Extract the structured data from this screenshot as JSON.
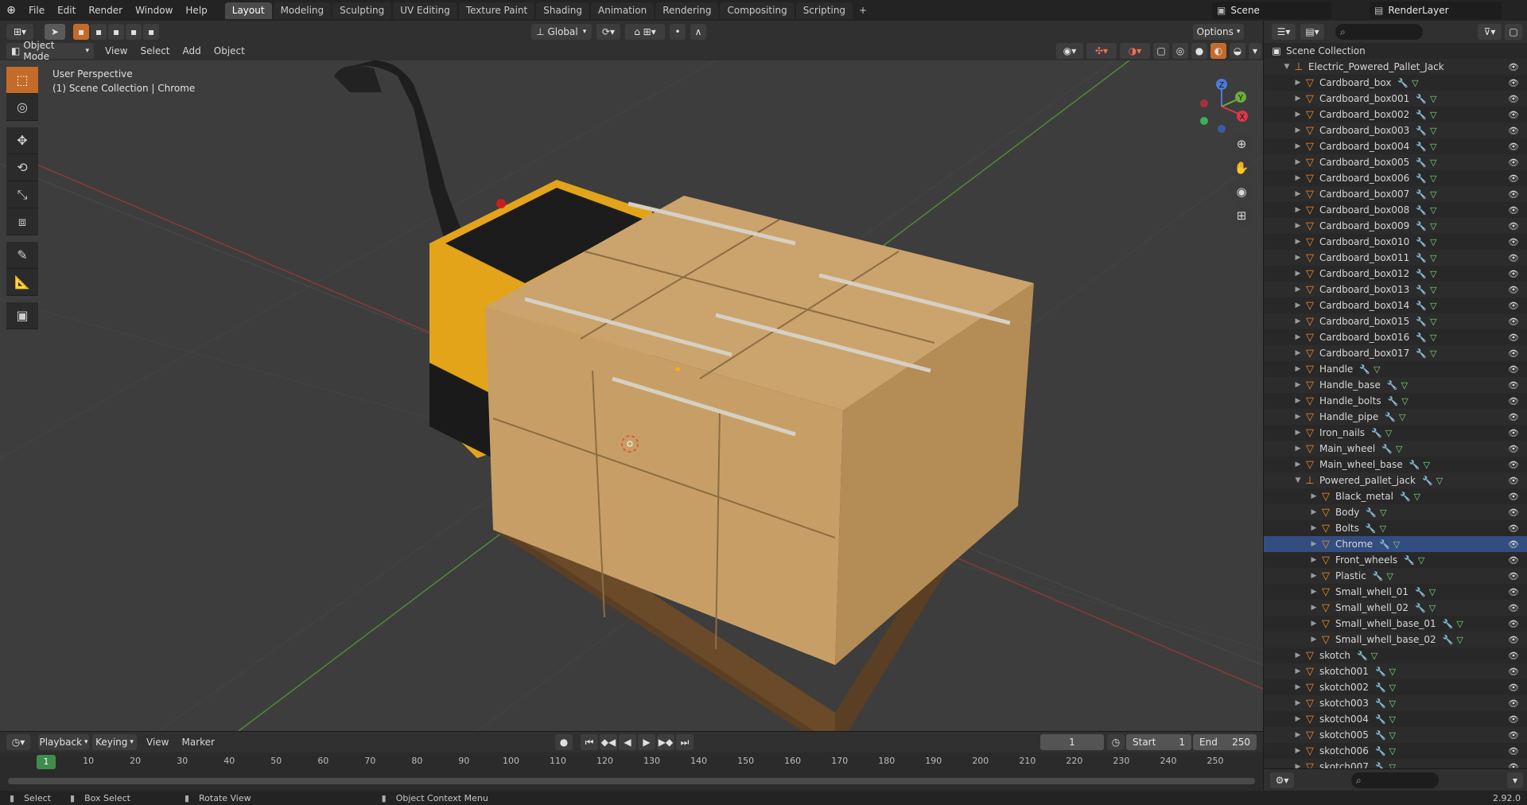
{
  "menu": {
    "file": "File",
    "edit": "Edit",
    "render": "Render",
    "window": "Window",
    "help": "Help"
  },
  "workspaces": [
    "Layout",
    "Modeling",
    "Sculpting",
    "UV Editing",
    "Texture Paint",
    "Shading",
    "Animation",
    "Rendering",
    "Compositing",
    "Scripting"
  ],
  "workspace_add": "+",
  "scene": "Scene",
  "render_layer": "RenderLayer",
  "header": {
    "mode": "Object Mode",
    "view": "View",
    "select": "Select",
    "add": "Add",
    "object": "Object",
    "orientation": "Global",
    "options": "Options"
  },
  "viewport": {
    "perspective": "User Perspective",
    "collection": "(1) Scene Collection | Chrome"
  },
  "gizmo": {
    "x": "X",
    "y": "Y",
    "z": "Z"
  },
  "outliner": {
    "title": "Scene Collection",
    "root": "Electric_Powered_Pallet_Jack",
    "items": [
      "Cardboard_box",
      "Cardboard_box001",
      "Cardboard_box002",
      "Cardboard_box003",
      "Cardboard_box004",
      "Cardboard_box005",
      "Cardboard_box006",
      "Cardboard_box007",
      "Cardboard_box008",
      "Cardboard_box009",
      "Cardboard_box010",
      "Cardboard_box011",
      "Cardboard_box012",
      "Cardboard_box013",
      "Cardboard_box014",
      "Cardboard_box015",
      "Cardboard_box016",
      "Cardboard_box017",
      "Handle",
      "Handle_base",
      "Handle_bolts",
      "Handle_pipe",
      "Iron_nails",
      "Main_wheel",
      "Main_wheel_base"
    ],
    "sub_collection": "Powered_pallet_jack",
    "sub_items": [
      "Black_metal",
      "Body",
      "Bolts",
      "Chrome",
      "Front_wheels",
      "Plastic",
      "Small_whell_01",
      "Small_whell_02",
      "Small_whell_base_01",
      "Small_whell_base_02"
    ],
    "tail_items": [
      "skotch",
      "skotch001",
      "skotch002",
      "skotch003",
      "skotch004",
      "skotch005",
      "skotch006",
      "skotch007"
    ],
    "selected": "Chrome"
  },
  "timeline": {
    "playback": "Playback",
    "keying": "Keying",
    "view": "View",
    "marker": "Marker",
    "current_frame": "1",
    "start_label": "Start",
    "start": "1",
    "end_label": "End",
    "end": "250",
    "ticks": [
      "1",
      "10",
      "20",
      "30",
      "40",
      "50",
      "60",
      "70",
      "80",
      "90",
      "100",
      "110",
      "120",
      "130",
      "140",
      "150",
      "160",
      "170",
      "180",
      "190",
      "200",
      "210",
      "220",
      "230",
      "240",
      "250"
    ]
  },
  "status": {
    "select": "Select",
    "box_select": "Box Select",
    "rotate_view": "Rotate View",
    "context_menu": "Object Context Menu",
    "version": "2.92.0"
  }
}
